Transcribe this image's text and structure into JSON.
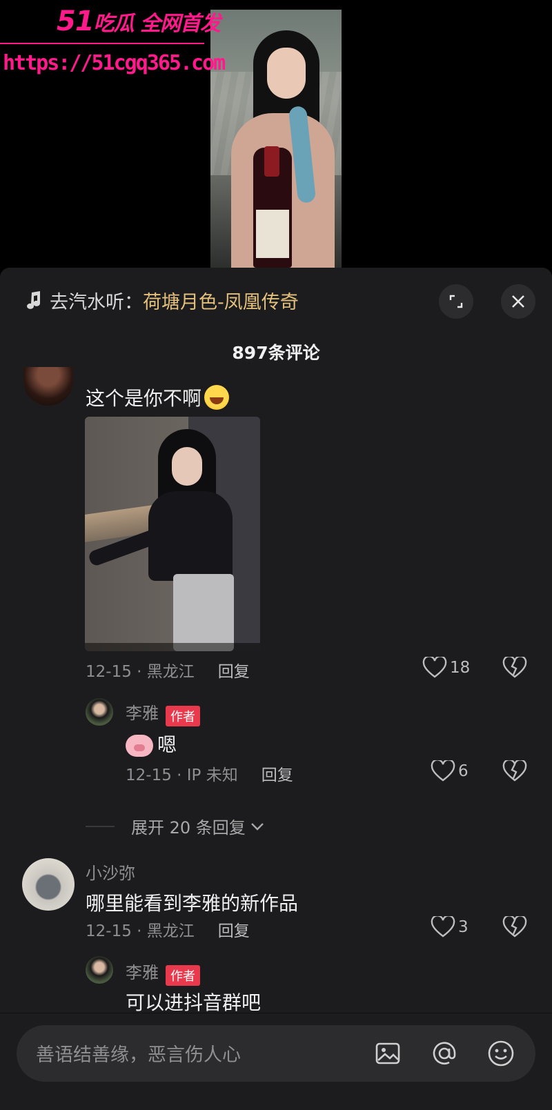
{
  "watermark": {
    "brand_prefix": "51",
    "brand_text": "吃瓜 全网首发",
    "url": "https://51cgq365.com"
  },
  "music": {
    "prefix": "去汽水听：",
    "title": "荷塘月色-凤凰传奇",
    "note_icon": "music-note-icon"
  },
  "comments_header": {
    "count_label": "897条评论"
  },
  "comments": [
    {
      "text": "这个是你不啊",
      "date_location": "12-15 · 黑龙江",
      "reply_label": "回复",
      "likes": "18"
    },
    {
      "author": "李雅",
      "author_tag": "作者",
      "text": "嗯",
      "date_location": "12-15 · IP 未知",
      "reply_label": "回复",
      "likes": "6"
    },
    {
      "author": "小沙弥",
      "text": "哪里能看到李雅的新作品",
      "date_location": "12-15 · 黑龙江",
      "reply_label": "回复",
      "likes": "3"
    },
    {
      "author": "李雅",
      "author_tag": "作者",
      "text": "可以进抖音群吧"
    }
  ],
  "expand_replies": {
    "label": "展开 20 条回复"
  },
  "composer": {
    "placeholder": "善语结善缘，恶言伤人心"
  },
  "colors": {
    "sheet_bg": "#1c1c1e",
    "music_title": "#e3c07b",
    "author_tag": "#e8394d",
    "watermark": "#ff1a8c"
  }
}
